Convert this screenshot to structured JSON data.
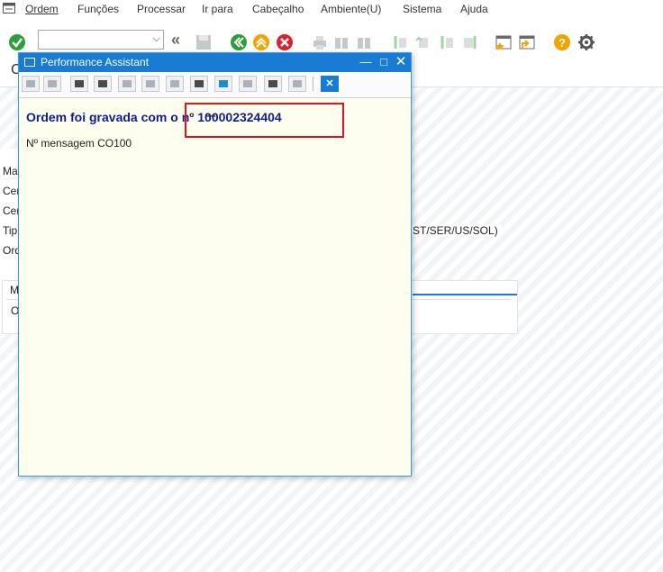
{
  "menubar": {
    "items": [
      "Ordem",
      "Funções",
      "Processar",
      "Ir para",
      "Cabeçalho",
      "Ambiente(U)",
      "Sistema",
      "Ajuda"
    ]
  },
  "toolbar": {
    "command_field_value": "",
    "icons": [
      "enter-icon",
      "back-icon",
      "exit-icon",
      "cancel-icon",
      "print-icon",
      "find-icon",
      "first-page-icon",
      "prev-page-icon",
      "next-page-icon",
      "last-page-icon",
      "new-session-icon",
      "shortcut-icon",
      "help-icon",
      "settings-icon"
    ]
  },
  "background": {
    "partial_title": "C",
    "labels": [
      "Mat",
      "Cen",
      "Cen",
      "Tip",
      "Ord"
    ],
    "tail_text": "ST/SER/US/SOL)",
    "frame_tab": "Me",
    "frame_row": "O"
  },
  "dialog": {
    "title": "Performance Assistant",
    "message": "Ordem foi gravada com o nº 100002324404",
    "message_number": "Nº mensagem CO100",
    "toolbar_icons": [
      "back-icon",
      "forward-icon",
      "document-icon",
      "technical-info-icon",
      "edit-icon",
      "edit2-icon",
      "user-icon",
      "calendar-icon",
      "highlight-icon",
      "link-icon",
      "print-icon",
      "binoculars-icon",
      "close-icon"
    ]
  },
  "colors": {
    "titlebar": "#1a7bd4",
    "dialog_bg": "#fefeee",
    "message_text": "#0d1d8c",
    "highlight_box": "#e0141e"
  }
}
